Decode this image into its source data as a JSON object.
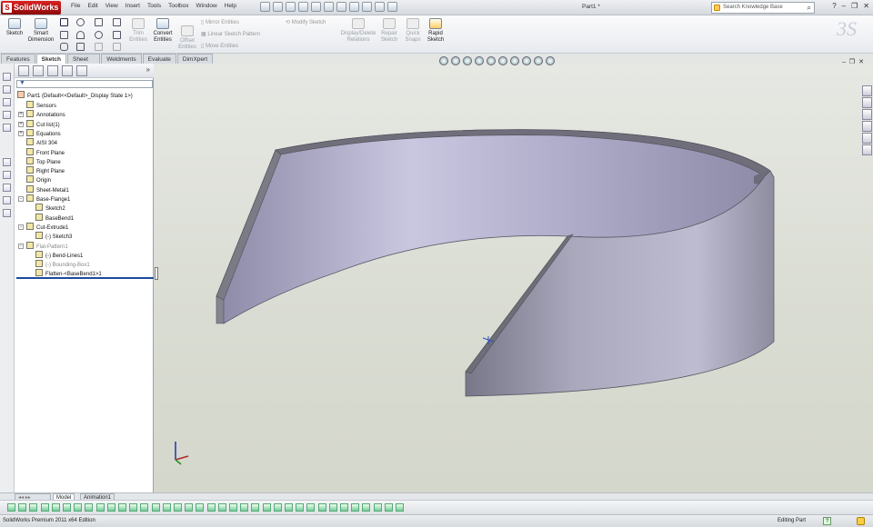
{
  "app": {
    "logo": "SolidWorks",
    "document_title": "Part1 *"
  },
  "menu": [
    "File",
    "Edit",
    "View",
    "Insert",
    "Tools",
    "Toolbox",
    "Window",
    "Help"
  ],
  "search": {
    "placeholder": "Search Knowledge Base"
  },
  "command_manager": {
    "sketch": "Sketch",
    "smart_dimension_l1": "Smart",
    "smart_dimension_l2": "Dimension",
    "trim_l1": "Trim",
    "trim_l2": "Entities",
    "convert_l1": "Convert",
    "convert_l2": "Entities",
    "offset_l1": "Offset",
    "offset_l2": "Entities",
    "mirror": "Mirror Entities",
    "linear_pattern": "Linear Sketch Pattern",
    "move": "Move Entities",
    "modify": "Modify Sketch",
    "display_relations_l1": "Display/Delete",
    "display_relations_l2": "Relations",
    "repair_l1": "Repair",
    "repair_l2": "Sketch",
    "quick_snaps_l1": "Quick",
    "quick_snaps_l2": "Snaps",
    "rapid_l1": "Rapid",
    "rapid_l2": "Sketch"
  },
  "tabs": [
    "Features",
    "Sketch",
    "Sheet Metal",
    "Weldments",
    "Evaluate",
    "DimXpert"
  ],
  "active_tab": "Sketch",
  "feature_tree": {
    "root": "Part1  (Default<<Default>_Display State 1>)",
    "items": [
      {
        "label": "Sensors",
        "indent": 1,
        "expander": ""
      },
      {
        "label": "Annotations",
        "indent": 1,
        "expander": "+"
      },
      {
        "label": "Cut list(1)",
        "indent": 1,
        "expander": "+"
      },
      {
        "label": "Equations",
        "indent": 1,
        "expander": "+"
      },
      {
        "label": "AISI 304",
        "indent": 1,
        "expander": ""
      },
      {
        "label": "Front Plane",
        "indent": 1,
        "expander": ""
      },
      {
        "label": "Top Plane",
        "indent": 1,
        "expander": ""
      },
      {
        "label": "Right Plane",
        "indent": 1,
        "expander": ""
      },
      {
        "label": "Origin",
        "indent": 1,
        "expander": ""
      },
      {
        "label": "Sheet-Metal1",
        "indent": 1,
        "expander": ""
      },
      {
        "label": "Base-Flange1",
        "indent": 1,
        "expander": "-"
      },
      {
        "label": "Sketch2",
        "indent": 2,
        "expander": ""
      },
      {
        "label": "BaseBend1",
        "indent": 2,
        "expander": ""
      },
      {
        "label": "Cut-Extrude1",
        "indent": 1,
        "expander": "-"
      },
      {
        "label": "(-) Sketch3",
        "indent": 2,
        "expander": ""
      },
      {
        "label": "Flat-Pattern1",
        "indent": 1,
        "expander": "-",
        "grey": true
      },
      {
        "label": "(-) Bend-Lines1",
        "indent": 2,
        "expander": ""
      },
      {
        "label": "(-) Bounding-Box1",
        "indent": 2,
        "expander": "",
        "grey": true
      },
      {
        "label": "Flatten-<BaseBend1>1",
        "indent": 2,
        "expander": ""
      }
    ]
  },
  "bottom_tabs": {
    "model": "Model",
    "animation": "Animation1"
  },
  "status": {
    "left": "SolidWorks Premium 2011 x64 Edition",
    "mode": "Editing Part",
    "help": "?"
  },
  "colors": {
    "part_face": "#a9a6c4",
    "part_edge": "#7a7a86",
    "viewport_bg": "#dcdfd5"
  }
}
